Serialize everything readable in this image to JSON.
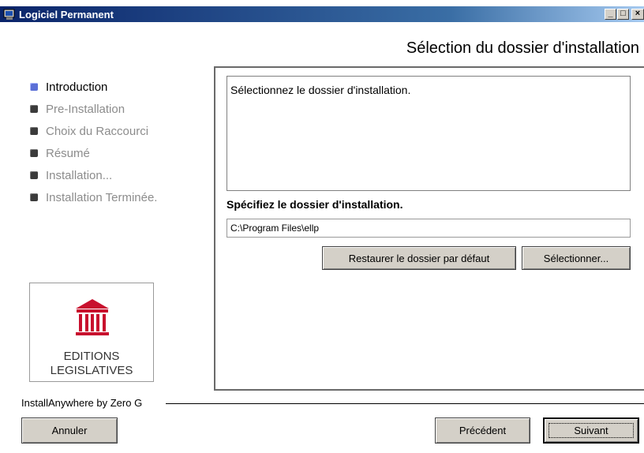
{
  "window": {
    "title": "Logiciel Permanent",
    "controls": {
      "minimize": "_",
      "maximize": "□",
      "close": "×"
    }
  },
  "header": {
    "title": "Sélection du dossier d'installation"
  },
  "steps": [
    {
      "label": "Introduction",
      "active": true
    },
    {
      "label": "Pre-Installation",
      "active": false
    },
    {
      "label": "Choix du Raccourci",
      "active": false
    },
    {
      "label": "Résumé",
      "active": false
    },
    {
      "label": "Installation...",
      "active": false
    },
    {
      "label": "Installation Terminée.",
      "active": false
    }
  ],
  "logo": {
    "line1": "EDITIONS",
    "line2": "LEGISLATIVES",
    "color": "#c8102e"
  },
  "main": {
    "message": "Sélectionnez le dossier d'installation.",
    "field_label": "Spécifiez le dossier d'installation.",
    "path_value": "C:\\Program Files\\ellp",
    "restore_button": "Restaurer le dossier par défaut",
    "select_button": "Sélectionner..."
  },
  "footer": {
    "brand": "InstallAnywhere by Zero G",
    "cancel_button": "Annuler",
    "prev_button": "Précédent",
    "next_button": "Suivant"
  },
  "colors": {
    "titlebar_start": "#0a246a",
    "active_bullet": "#5b6fd6",
    "button_face": "#d4d0c8"
  }
}
